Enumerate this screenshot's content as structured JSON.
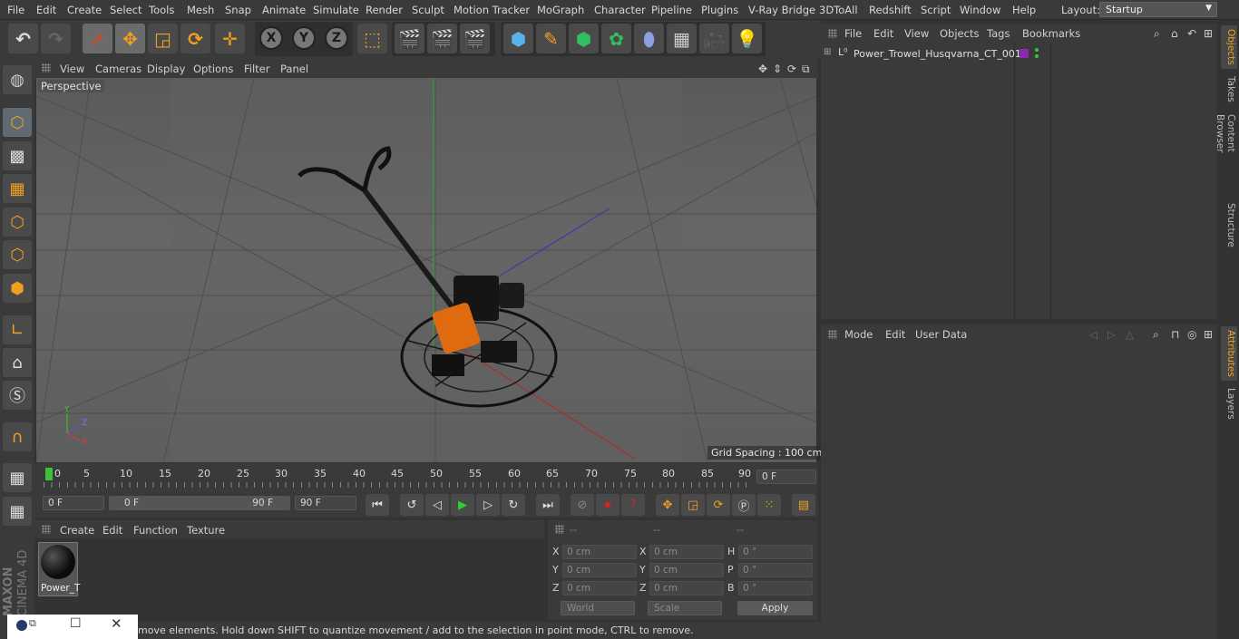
{
  "menu": [
    "File",
    "Edit",
    "Create",
    "Select",
    "Tools",
    "Mesh",
    "Snap",
    "Animate",
    "Simulate",
    "Render",
    "Sculpt",
    "Motion Tracker",
    "MoGraph",
    "Character",
    "Pipeline",
    "Plugins",
    "V-Ray Bridge",
    "3DToAll",
    "Redshift",
    "Script",
    "Window",
    "Help"
  ],
  "layout": {
    "label": "Layout:",
    "value": "Startup"
  },
  "viewport": {
    "menu": [
      "View",
      "Cameras",
      "Display",
      "Options",
      "Filter",
      "Panel"
    ],
    "camera_label": "Perspective",
    "grid_spacing": "Grid Spacing : 100 cm"
  },
  "timeline": {
    "ticks": [
      "0",
      "5",
      "10",
      "15",
      "20",
      "25",
      "30",
      "35",
      "40",
      "45",
      "50",
      "55",
      "60",
      "65",
      "70",
      "75",
      "80",
      "85",
      "90"
    ],
    "current_frame": "0 F",
    "start_frame": "0 F",
    "range_start": "0 F",
    "range_end": "90 F",
    "end_frame": "90 F"
  },
  "material": {
    "menu": [
      "Create",
      "Edit",
      "Function",
      "Texture"
    ],
    "item_name": "Power_T"
  },
  "coords": {
    "headers": [
      "--",
      "--",
      "--"
    ],
    "pos": {
      "x": "0 cm",
      "y": "0 cm",
      "z": "0 cm"
    },
    "size": {
      "x": "0 cm",
      "y": "0 cm",
      "z": "0 cm"
    },
    "rot": {
      "h": "0 °",
      "p": "0 °",
      "b": "0 °"
    },
    "labels": {
      "x": "X",
      "y": "Y",
      "z": "Z",
      "h": "H",
      "p": "P",
      "b": "B"
    },
    "mode": "World",
    "scale": "Scale",
    "apply": "Apply"
  },
  "status": "move elements. Hold down SHIFT to quantize movement / add to the selection in point mode, CTRL to remove.",
  "objects": {
    "menu": [
      "File",
      "Edit",
      "View",
      "Objects",
      "Tags",
      "Bookmarks"
    ],
    "item": "Power_Trowel_Husqvarna_CT_001"
  },
  "attributes": {
    "menu": [
      "Mode",
      "Edit",
      "User Data"
    ]
  },
  "side_tabs": [
    "Objects",
    "Takes",
    "Content Browser",
    "Structure"
  ],
  "side_tabs_lower": [
    "Attributes",
    "Layers"
  ],
  "brand": {
    "maxon": "MAXON",
    "product": "CINEMA 4D"
  },
  "colors": {
    "accent": "#f0a020",
    "blue": "#5ab0e8",
    "play": "#30d030"
  }
}
